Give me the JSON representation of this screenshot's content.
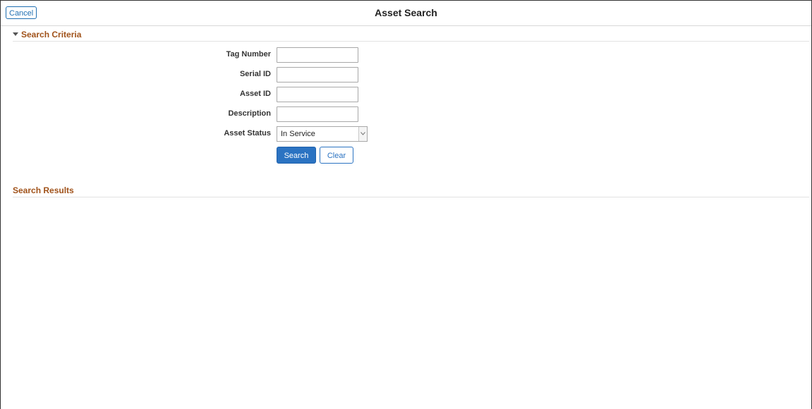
{
  "header": {
    "title": "Asset Search",
    "cancel_label": "Cancel"
  },
  "criteria": {
    "title": "Search Criteria",
    "fields": [
      {
        "label": "Tag Number",
        "value": ""
      },
      {
        "label": "Serial ID",
        "value": ""
      },
      {
        "label": "Asset ID",
        "value": ""
      },
      {
        "label": "Description",
        "value": ""
      }
    ],
    "status": {
      "label": "Asset Status",
      "selected": "In Service"
    },
    "search_label": "Search",
    "clear_label": "Clear"
  },
  "results": {
    "title": "Search Results"
  },
  "colors": {
    "section_title": "#a0521a",
    "primary_button": "#2b73c2",
    "link_blue": "#1f6fb2"
  }
}
